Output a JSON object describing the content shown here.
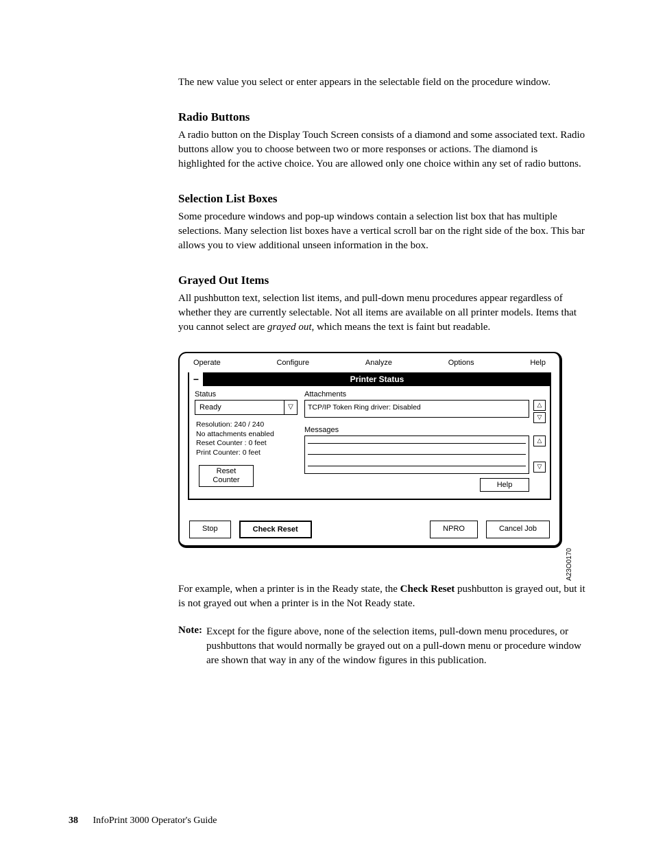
{
  "p_intro": "The new value you select or enter appears in the selectable field on the procedure window.",
  "h_radio": "Radio Buttons",
  "p_radio": "A radio button on the Display Touch Screen consists of a diamond and some associated text. Radio buttons allow you to choose between two or more responses or actions. The diamond is highlighted for the active choice. You are allowed only one choice within any set of radio buttons.",
  "h_listbox": "Selection List Boxes",
  "p_listbox": "Some procedure windows and pop-up windows contain a selection list box that has multiple selections. Many selection list boxes have a vertical scroll bar on the right side of the box. This bar allows you to view additional unseen information in the box.",
  "h_grayed": "Grayed Out Items",
  "p_grayed_1a": "All pushbutton text, selection list items, and pull-down menu procedures appear regardless of whether they are currently selectable. Not all items are available on all printer models. Items that you cannot select are ",
  "p_grayed_1b": "grayed out",
  "p_grayed_1c": ", which means the text is faint but readable.",
  "p_example_1a": "For example, when a printer is in the Ready state, the ",
  "p_example_1b": "Check Reset",
  "p_example_1c": " pushbutton is grayed out, but it is not grayed out when a printer is in the Not Ready state.",
  "note_label": "Note:",
  "note_text": "Except for the figure above, none of the selection items, pull-down menu procedures, or pushbuttons that would normally be grayed out on a pull-down menu or procedure window are shown that way in any of the window figures in this publication.",
  "footer_page": "38",
  "footer_title": "InfoPrint 3000 Operator's Guide",
  "figure": {
    "menu": {
      "operate": "Operate",
      "configure": "Configure",
      "analyze": "Analyze",
      "options": "Options",
      "help": "Help"
    },
    "title": "Printer Status",
    "status_label": "Status",
    "status_value": "Ready",
    "info": {
      "l1": "Resolution: 240 / 240",
      "l2": "No attachments enabled",
      "l3": "Reset Counter : 0 feet",
      "l4": "Print Counter: 0 feet"
    },
    "reset_btn_l1": "Reset",
    "reset_btn_l2": "Counter",
    "attach_label": "Attachments",
    "attach_value": "TCP/IP Token Ring driver: Disabled",
    "messages_label": "Messages",
    "help_btn": "Help",
    "bottom": {
      "stop": "Stop",
      "check_reset": "Check Reset",
      "npro": "NPRO",
      "cancel": "Cancel Job"
    },
    "id": "A23O0170"
  }
}
